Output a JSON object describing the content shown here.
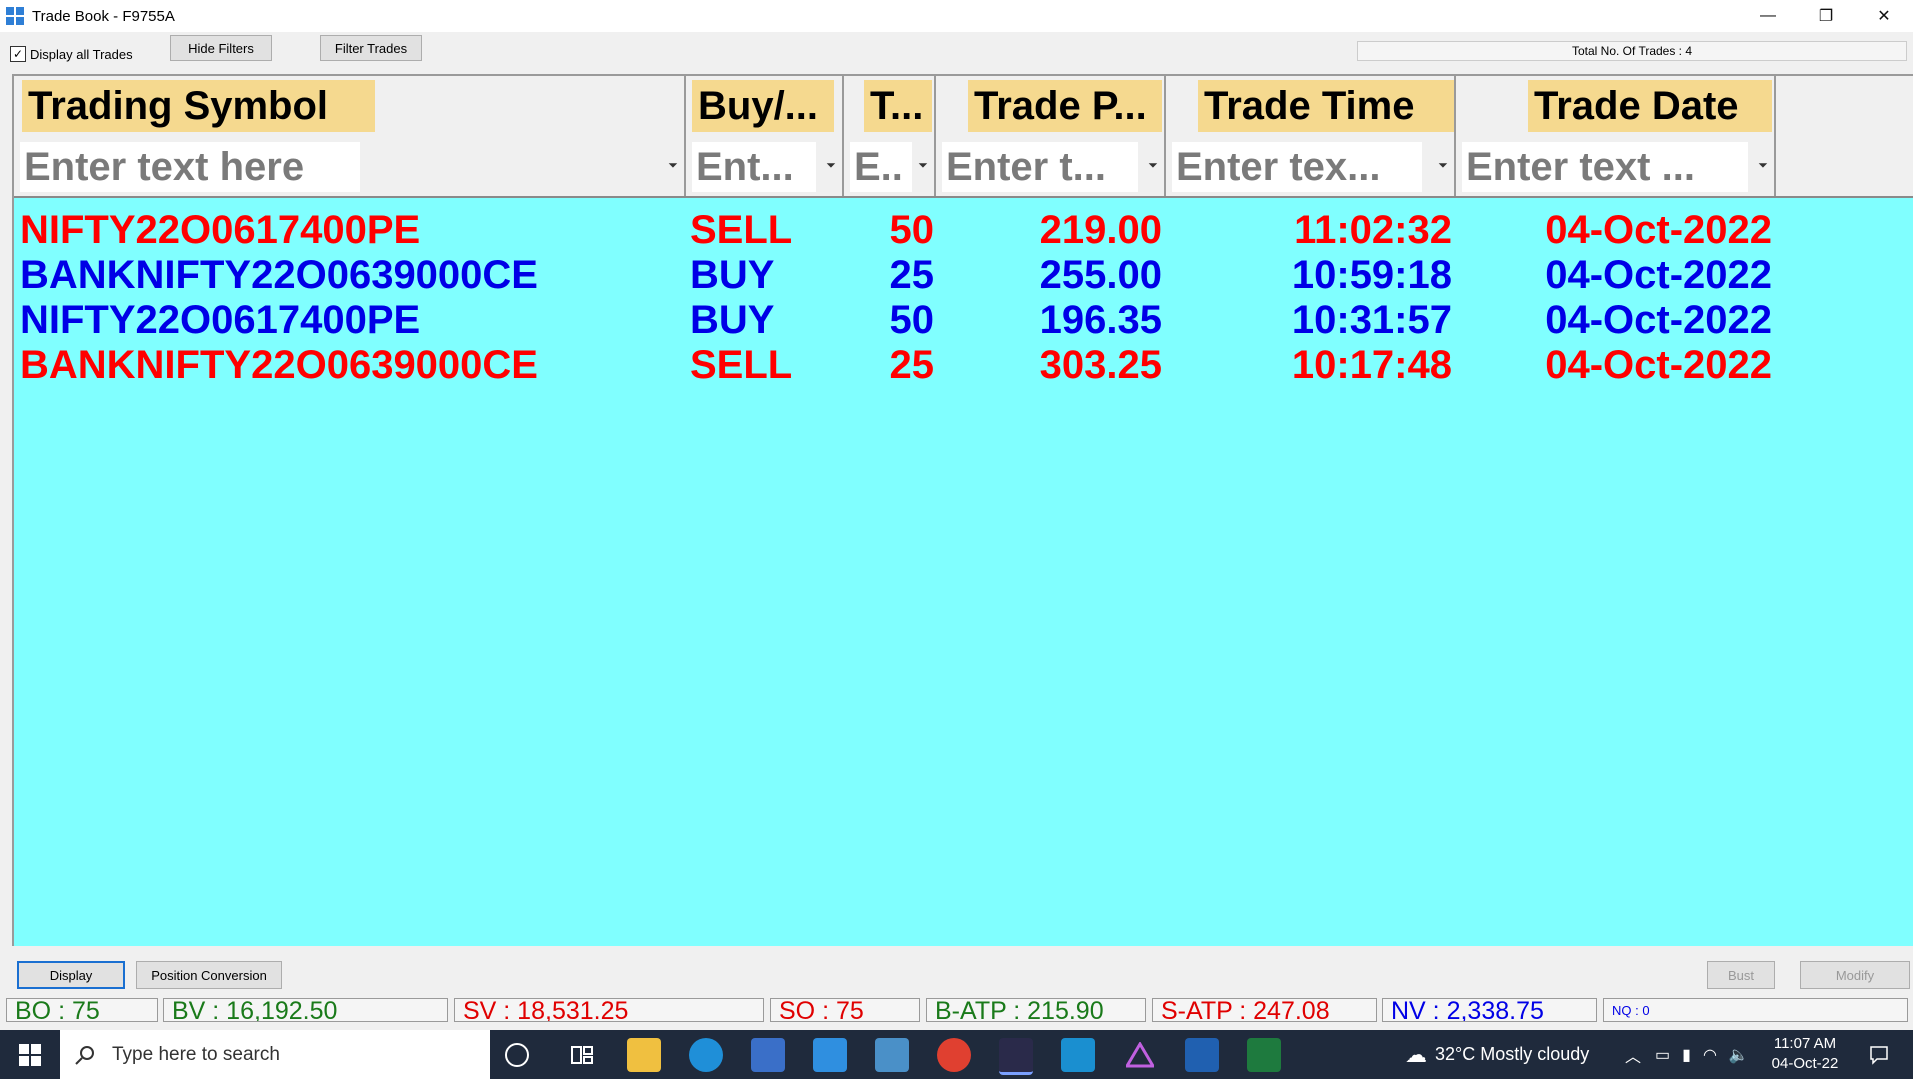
{
  "window": {
    "title": "Trade Book - F9755A",
    "minimize_glyph": "—",
    "restore_glyph": "❐",
    "close_glyph": "✕"
  },
  "toolbar": {
    "display_all_label": "Display all Trades",
    "display_all_checked": "✓",
    "hide_filters_label": "Hide Filters",
    "filter_trades_label": "Filter Trades",
    "total_trades_label": "Total No. Of Trades : 4"
  },
  "columns": [
    {
      "header": "Trading Symbol",
      "filter_placeholder": "Enter text here"
    },
    {
      "header": "Buy/...",
      "filter_placeholder": "Ent..."
    },
    {
      "header": "T...",
      "filter_placeholder": "E.."
    },
    {
      "header": "Trade P...",
      "filter_placeholder": "Enter t..."
    },
    {
      "header": "Trade Time",
      "filter_placeholder": "Enter tex..."
    },
    {
      "header": "Trade Date",
      "filter_placeholder": "Enter text ..."
    }
  ],
  "filter_icon": "⏷",
  "rows": [
    {
      "symbol": "NIFTY22O0617400PE",
      "side": "SELL",
      "qty": "50",
      "price": "219.00",
      "time": "11:02:32",
      "date": "04-Oct-2022",
      "color": "#ff0000"
    },
    {
      "symbol": "BANKNIFTY22O0639000CE",
      "side": "BUY",
      "qty": "25",
      "price": "255.00",
      "time": "10:59:18",
      "date": "04-Oct-2022",
      "color": "#0000e6"
    },
    {
      "symbol": "NIFTY22O0617400PE",
      "side": "BUY",
      "qty": "50",
      "price": "196.35",
      "time": "10:31:57",
      "date": "04-Oct-2022",
      "color": "#0000e6"
    },
    {
      "symbol": "BANKNIFTY22O0639000CE",
      "side": "SELL",
      "qty": "25",
      "price": "303.25",
      "time": "10:17:48",
      "date": "04-Oct-2022",
      "color": "#ff0000"
    }
  ],
  "bottom": {
    "display_label": "Display",
    "position_conversion_label": "Position Conversion",
    "bust_label": "Bust",
    "modify_label": "Modify"
  },
  "status": {
    "bo": "BO : 75",
    "bv": "BV : 16,192.50",
    "sv": "SV : 18,531.25",
    "so": "SO : 75",
    "batp": "B-ATP : 215.90",
    "satp": "S-ATP : 247.08",
    "nv": "NV : 2,338.75",
    "nq": "NQ : 0"
  },
  "colors": {
    "grid_bg": "#80ffff",
    "header_bg": "#f5d98f",
    "buy": "#0000e6",
    "sell": "#ff0000",
    "green_text": "#1a7a1a",
    "red_text": "#e00000",
    "blue_text": "#0000e6"
  },
  "taskbar": {
    "search_placeholder": "Type here to search",
    "weather": "32°C  Mostly cloudy",
    "time": "11:07 AM",
    "date": "04-Oct-22"
  }
}
